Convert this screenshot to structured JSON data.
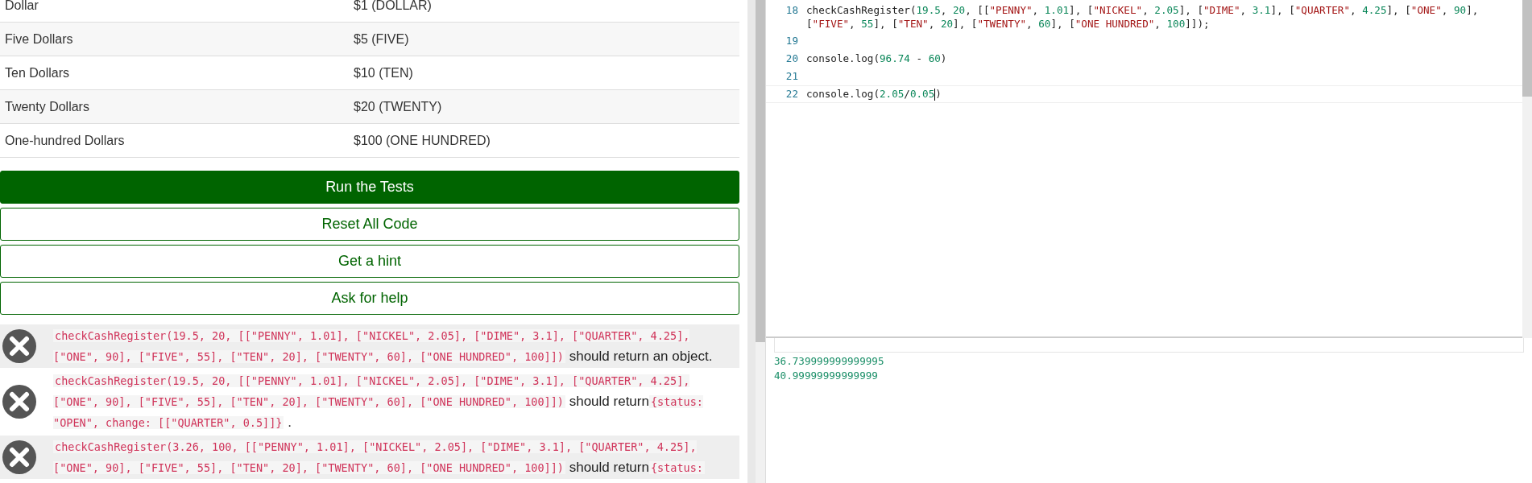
{
  "table": {
    "rows": [
      {
        "name": "Dollar",
        "amount": "$1 (DOLLAR)"
      },
      {
        "name": "Five Dollars",
        "amount": "$5 (FIVE)"
      },
      {
        "name": "Ten Dollars",
        "amount": "$10 (TEN)"
      },
      {
        "name": "Twenty Dollars",
        "amount": "$20 (TWENTY)"
      },
      {
        "name": "One-hundred Dollars",
        "amount": "$100 (ONE HUNDRED)"
      }
    ]
  },
  "buttons": [
    {
      "label": "Run the Tests",
      "kind": "primary"
    },
    {
      "label": "Reset All Code",
      "kind": "outline"
    },
    {
      "label": "Get a hint",
      "kind": "outline"
    },
    {
      "label": "Ask for help",
      "kind": "outline"
    }
  ],
  "tests": [
    {
      "passed": false,
      "parts": [
        {
          "kind": "code",
          "text": "checkCashRegister(19.5, 20, [[\"PENNY\", 1.01], [\"NICKEL\", 2.05], [\"DIME\", 3.1], [\"QUARTER\", 4.25], [\"ONE\", 90], [\"FIVE\", 55], [\"TEN\", 20], [\"TWENTY\", 60], [\"ONE HUNDRED\", 100]])"
        },
        {
          "kind": "text",
          "text": "should return an object."
        }
      ]
    },
    {
      "passed": false,
      "parts": [
        {
          "kind": "code",
          "text": "checkCashRegister(19.5, 20, [[\"PENNY\", 1.01], [\"NICKEL\", 2.05], [\"DIME\", 3.1], [\"QUARTER\", 4.25], [\"ONE\", 90], [\"FIVE\", 55], [\"TEN\", 20], [\"TWENTY\", 60], [\"ONE HUNDRED\", 100]])"
        },
        {
          "kind": "text",
          "text": "should return"
        },
        {
          "kind": "code",
          "text": "{status: \"OPEN\", change: [[\"QUARTER\", 0.5]]}"
        },
        {
          "kind": "text",
          "text": "."
        }
      ]
    },
    {
      "passed": false,
      "parts": [
        {
          "kind": "code",
          "text": "checkCashRegister(3.26, 100, [[\"PENNY\", 1.01], [\"NICKEL\", 2.05], [\"DIME\", 3.1], [\"QUARTER\", 4.25], [\"ONE\", 90], [\"FIVE\", 55], [\"TEN\", 20], [\"TWENTY\", 60], [\"ONE HUNDRED\", 100]])"
        },
        {
          "kind": "text",
          "text": "should return"
        },
        {
          "kind": "code",
          "text": "{status:"
        }
      ]
    }
  ],
  "editor": {
    "lines": [
      {
        "number": "18",
        "active": false,
        "tokens": [
          {
            "kind": "plain",
            "text": "checkCashRegister("
          },
          {
            "kind": "number",
            "text": "19.5"
          },
          {
            "kind": "plain",
            "text": ", "
          },
          {
            "kind": "number",
            "text": "20"
          },
          {
            "kind": "plain",
            "text": ", [["
          },
          {
            "kind": "string",
            "text": "\"PENNY\""
          },
          {
            "kind": "plain",
            "text": ", "
          },
          {
            "kind": "number",
            "text": "1.01"
          },
          {
            "kind": "plain",
            "text": "], ["
          },
          {
            "kind": "string",
            "text": "\"NICKEL\""
          },
          {
            "kind": "plain",
            "text": ", "
          },
          {
            "kind": "number",
            "text": "2.05"
          },
          {
            "kind": "plain",
            "text": "], ["
          },
          {
            "kind": "string",
            "text": "\"DIME\""
          },
          {
            "kind": "plain",
            "text": ", "
          },
          {
            "kind": "number",
            "text": "3.1"
          },
          {
            "kind": "plain",
            "text": "], ["
          },
          {
            "kind": "string",
            "text": "\"QUARTER\""
          },
          {
            "kind": "plain",
            "text": ", "
          },
          {
            "kind": "number",
            "text": "4.25"
          },
          {
            "kind": "plain",
            "text": "], ["
          },
          {
            "kind": "string",
            "text": "\"ONE\""
          },
          {
            "kind": "plain",
            "text": ", "
          },
          {
            "kind": "number",
            "text": "90"
          },
          {
            "kind": "plain",
            "text": "], ["
          },
          {
            "kind": "string",
            "text": "\"FIVE\""
          },
          {
            "kind": "plain",
            "text": ", "
          },
          {
            "kind": "number",
            "text": "55"
          },
          {
            "kind": "plain",
            "text": "], ["
          },
          {
            "kind": "string",
            "text": "\"TEN\""
          },
          {
            "kind": "plain",
            "text": ", "
          },
          {
            "kind": "number",
            "text": "20"
          },
          {
            "kind": "plain",
            "text": "], ["
          },
          {
            "kind": "string",
            "text": "\"TWENTY\""
          },
          {
            "kind": "plain",
            "text": ", "
          },
          {
            "kind": "number",
            "text": "60"
          },
          {
            "kind": "plain",
            "text": "], ["
          },
          {
            "kind": "string",
            "text": "\"ONE HUNDRED\""
          },
          {
            "kind": "plain",
            "text": ", "
          },
          {
            "kind": "number",
            "text": "100"
          },
          {
            "kind": "plain",
            "text": "]]);"
          }
        ]
      },
      {
        "number": "19",
        "active": false
      },
      {
        "number": "20",
        "active": false,
        "tokens": [
          {
            "kind": "plain",
            "text": "console.log("
          },
          {
            "kind": "number",
            "text": "96.74"
          },
          {
            "kind": "plain",
            "text": " - "
          },
          {
            "kind": "number",
            "text": "60"
          },
          {
            "kind": "plain",
            "text": ")"
          }
        ]
      },
      {
        "number": "21",
        "active": false
      },
      {
        "number": "22",
        "active": true,
        "tokens": [
          {
            "kind": "plain",
            "text": "console.log("
          },
          {
            "kind": "number",
            "text": "2.05"
          },
          {
            "kind": "plain",
            "text": "/"
          },
          {
            "kind": "number",
            "text": "0.05",
            "caret": true
          },
          {
            "kind": "plain",
            "text": ")"
          }
        ]
      }
    ]
  },
  "console": {
    "output": [
      "36.739999999999995",
      "40.99999999999999"
    ]
  }
}
